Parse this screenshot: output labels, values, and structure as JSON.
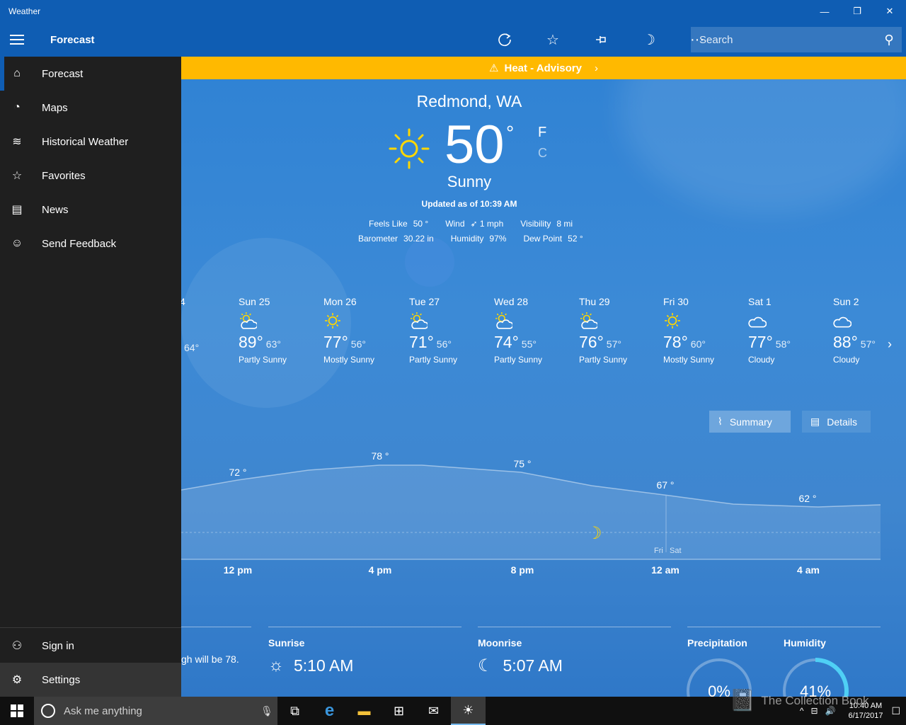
{
  "window": {
    "title": "Weather"
  },
  "commandbar": {
    "title": "Forecast",
    "search_placeholder": "Search"
  },
  "advisory": {
    "text": "Heat - Advisory"
  },
  "current": {
    "location": "Redmond, WA",
    "temp": "50",
    "degree": "°",
    "unit_f": "F",
    "unit_c": "C",
    "condition": "Sunny",
    "updated": "Updated as of 10:39 AM",
    "details": {
      "feels_like_label": "Feels Like",
      "feels_like": "50 °",
      "wind_label": "Wind",
      "wind": "1 mph",
      "visibility_label": "Visibility",
      "visibility": "8 mi",
      "barometer_label": "Barometer",
      "barometer": "30.22 in",
      "humidity_label": "Humidity",
      "humidity": "97%",
      "dew_point_label": "Dew Point",
      "dew_point": "52 °"
    }
  },
  "daily": {
    "partial_day": "4",
    "partial_lo": "64°",
    "days": [
      {
        "name": "Sun 25",
        "hi": "89°",
        "lo": "63°",
        "cond": "Partly Sunny",
        "icon": "partly-sunny"
      },
      {
        "name": "Mon 26",
        "hi": "77°",
        "lo": "56°",
        "cond": "Mostly Sunny",
        "icon": "sunny"
      },
      {
        "name": "Tue 27",
        "hi": "71°",
        "lo": "56°",
        "cond": "Partly Sunny",
        "icon": "partly-sunny"
      },
      {
        "name": "Wed 28",
        "hi": "74°",
        "lo": "55°",
        "cond": "Partly Sunny",
        "icon": "partly-sunny"
      },
      {
        "name": "Thu 29",
        "hi": "76°",
        "lo": "57°",
        "cond": "Partly Sunny",
        "icon": "partly-sunny"
      },
      {
        "name": "Fri 30",
        "hi": "78°",
        "lo": "60°",
        "cond": "Mostly Sunny",
        "icon": "sunny"
      },
      {
        "name": "Sat 1",
        "hi": "77°",
        "lo": "58°",
        "cond": "Cloudy",
        "icon": "cloudy"
      },
      {
        "name": "Sun 2",
        "hi": "88°",
        "lo": "57°",
        "cond": "Cloudy",
        "icon": "cloudy"
      }
    ]
  },
  "toggle": {
    "summary": "Summary",
    "details": "Details"
  },
  "hourly": {
    "temp_labels": [
      "72 °",
      "78 °",
      "75 °",
      "67 °",
      "62 °"
    ],
    "day_labels": [
      "Fri",
      "Sat"
    ],
    "times": [
      "12 pm",
      "4 pm",
      "8 pm",
      "12 am",
      "4 am"
    ]
  },
  "cards": {
    "partial_text": "gh will be 78.",
    "sunrise_title": "Sunrise",
    "sunrise": "5:10 AM",
    "moonrise_title": "Moonrise",
    "moonrise": "5:07 AM",
    "precip_title": "Precipitation",
    "precip": "0%",
    "precip_value": 0,
    "humidity_title": "Humidity",
    "humidity": "41%",
    "humidity_value": 41
  },
  "nav": {
    "items": [
      {
        "label": "Forecast",
        "icon": "home-icon"
      },
      {
        "label": "Maps",
        "icon": "maps-icon"
      },
      {
        "label": "Historical Weather",
        "icon": "chart-icon"
      },
      {
        "label": "Favorites",
        "icon": "favorites-icon"
      },
      {
        "label": "News",
        "icon": "news-icon"
      },
      {
        "label": "Send Feedback",
        "icon": "smiley-icon"
      }
    ],
    "bottom": [
      {
        "label": "Sign in",
        "icon": "person-icon"
      },
      {
        "label": "Settings",
        "icon": "gear-icon"
      }
    ]
  },
  "taskbar": {
    "search_placeholder": "Ask me anything",
    "time": "10:40 AM",
    "date": "6/17/2017",
    "watermark": "The Collection Book"
  }
}
